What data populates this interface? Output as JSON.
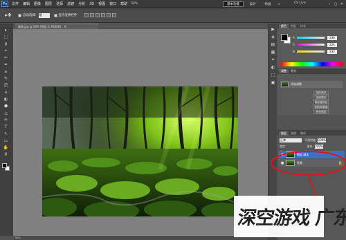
{
  "menubar": {
    "logo": "Ps",
    "items": [
      "文件",
      "编辑",
      "图像",
      "图层",
      "选择",
      "滤镜",
      "分析",
      "3D",
      "视图",
      "窗口",
      "帮助"
    ],
    "zoom": "50%",
    "workspace_active": "基本功能",
    "workspace_2": "设计",
    "workspace_3": "绘画",
    "workspace_more": "»",
    "cs_live": "CS Live",
    "win_min": "–",
    "win_max": "▢",
    "win_close": "✕"
  },
  "options": {
    "tool_icon": "move-tool-icon",
    "tool_glyph": "▸✥",
    "auto_select_label": "自动选择:",
    "auto_select_value": "组",
    "transform_label": "显示变换控件"
  },
  "document": {
    "tab_label": "森林.jpg @ 50% (图层 0, RGB/8)",
    "close_glyph": "×",
    "status_text": "50%"
  },
  "toolbox": {
    "tools": [
      "▸",
      "⬚",
      "ϙ",
      "⌖",
      "✂",
      "✒",
      "⌀",
      "✎",
      "⎚",
      "⌂",
      "◐",
      "⬢",
      "△",
      "✍",
      "T",
      "↖",
      "▭",
      "✋",
      "⚲"
    ]
  },
  "right_strip": {
    "icons": [
      "▶",
      "◈",
      "▤",
      "▦",
      "✦",
      "◐",
      "⬚",
      "▣"
    ]
  },
  "color_panel": {
    "tab_1": "颜色",
    "tab_2": "色板",
    "tab_3": "样式",
    "r_label": "R",
    "g_label": "G",
    "b_label": "B",
    "r_value": "236",
    "g_value": "224",
    "b_value": "232"
  },
  "adjustments_panel": {
    "tab_1": "调整",
    "tab_2": "蒙版",
    "preset_label": "添加调整",
    "buttons": [
      "色阶预设",
      "曲线预设",
      "曝光度预设",
      "色相/饱和度",
      "黑白预设"
    ]
  },
  "layers_panel": {
    "tab_1": "图层",
    "tab_2": "通道",
    "tab_3": "路径",
    "blend_mode": "正常",
    "opacity_label": "不透明度:",
    "opacity_value": "100%",
    "lock_label": "锁定:",
    "fill_label": "填充:",
    "fill_value": "100%",
    "layers": [
      {
        "name": "图层 副本",
        "selected": true
      },
      {
        "name": "背景",
        "selected": false,
        "locked": true
      }
    ],
    "eye_glyph": "●",
    "lock_glyph": "🔒"
  },
  "watermark": {
    "text": "深空游戏 广东龙网"
  },
  "colors": {
    "highlight_red": "#e0151b",
    "selected_layer_blue": "#3d6fc6"
  }
}
